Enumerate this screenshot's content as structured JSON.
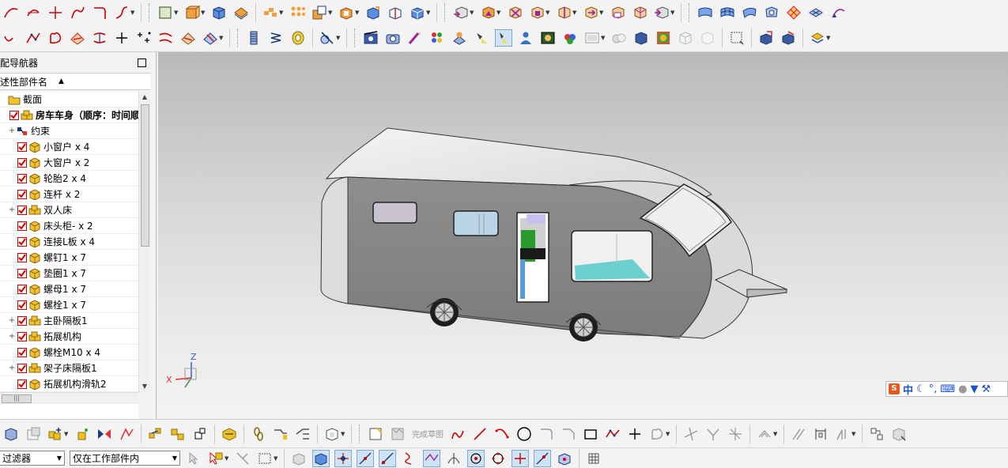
{
  "navigator": {
    "title": "配导航器",
    "column_header": "述性部件名",
    "tree": [
      {
        "label": "截面",
        "expander": "",
        "check": false,
        "icon": "folder-icon",
        "indent": 0
      },
      {
        "label": "房车车身（顺序：时间顺",
        "expander": "",
        "check": true,
        "icon": "assembly-icon",
        "bold": true,
        "indent": 0
      },
      {
        "label": "约束",
        "expander": "+",
        "check": false,
        "icon": "constraints-icon",
        "indent": 1
      },
      {
        "label": "小窗户 x 4",
        "expander": "",
        "check": true,
        "icon": "part-icon",
        "indent": 1
      },
      {
        "label": "大窗户 x 2",
        "expander": "",
        "check": true,
        "icon": "part-icon",
        "indent": 1
      },
      {
        "label": "轮胎2 x 4",
        "expander": "",
        "check": true,
        "icon": "part-icon",
        "indent": 1
      },
      {
        "label": "连杆 x 2",
        "expander": "",
        "check": true,
        "icon": "part-icon",
        "indent": 1
      },
      {
        "label": "双人床",
        "expander": "+",
        "check": true,
        "icon": "assembly-icon",
        "indent": 1
      },
      {
        "label": "床头柜- x 2",
        "expander": "",
        "check": true,
        "icon": "part-icon",
        "indent": 1
      },
      {
        "label": "连接L板 x 4",
        "expander": "",
        "check": true,
        "icon": "part-icon",
        "indent": 1
      },
      {
        "label": "螺钉1 x 7",
        "expander": "",
        "check": true,
        "icon": "part-icon",
        "indent": 1
      },
      {
        "label": "垫圈1 x 7",
        "expander": "",
        "check": true,
        "icon": "part-icon",
        "indent": 1
      },
      {
        "label": "螺母1 x 7",
        "expander": "",
        "check": true,
        "icon": "part-icon",
        "indent": 1
      },
      {
        "label": "螺栓1 x 7",
        "expander": "",
        "check": true,
        "icon": "part-icon",
        "indent": 1
      },
      {
        "label": "主卧隔板1",
        "expander": "+",
        "check": true,
        "icon": "assembly-icon",
        "indent": 1
      },
      {
        "label": "拓展机构",
        "expander": "+",
        "check": true,
        "icon": "assembly-icon",
        "indent": 1
      },
      {
        "label": "螺栓M10 x 4",
        "expander": "",
        "check": true,
        "icon": "part-icon",
        "indent": 1
      },
      {
        "label": "架子床隔板1",
        "expander": "+",
        "check": true,
        "icon": "assembly-icon",
        "indent": 1
      },
      {
        "label": "拓展机构滑轨2",
        "expander": "",
        "check": true,
        "icon": "part-icon",
        "indent": 1
      }
    ]
  },
  "viewport": {
    "triad": {
      "x_label": "X",
      "z_label": "Z"
    }
  },
  "ime_bar": {
    "logo": "S",
    "mode": "中",
    "items": [
      "moon-icon",
      "degree-icon",
      "keyboard-icon",
      "user-icon",
      "shirt-icon",
      "wrench-icon"
    ],
    "degree": "°,"
  },
  "bottom": {
    "finish_sketch_label": "完成草图",
    "filter_value": "过滤器",
    "scope_value": "仅在工作部件内"
  },
  "colors": {
    "check_red": "#cc0000",
    "part_yellow": "#f2c230",
    "body_grey": "#8c8c8c"
  }
}
